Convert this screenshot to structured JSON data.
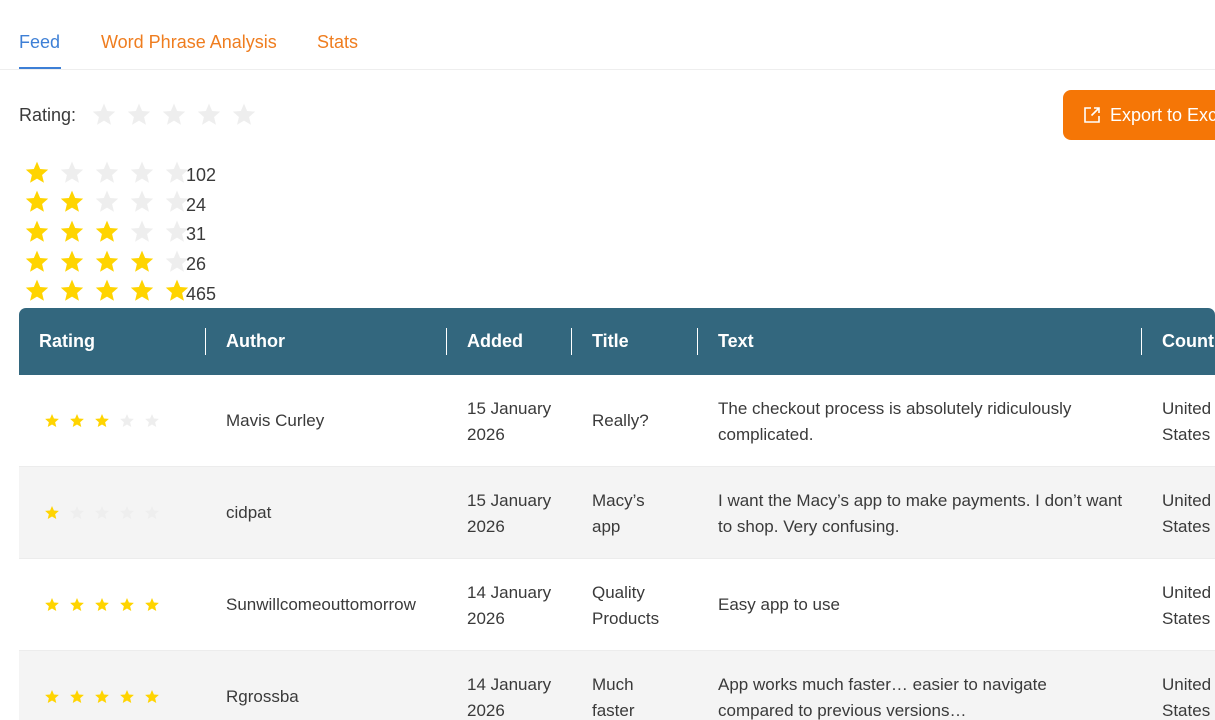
{
  "tabs": [
    {
      "label": "Feed",
      "active": true
    },
    {
      "label": "Word Phrase Analysis",
      "active": false
    },
    {
      "label": "Stats",
      "active": false
    }
  ],
  "filter": {
    "label": "Rating:",
    "selected": 0
  },
  "export": {
    "label": "Export to Excel"
  },
  "distribution": [
    {
      "stars": 1,
      "count": "102"
    },
    {
      "stars": 2,
      "count": "24"
    },
    {
      "stars": 3,
      "count": "31"
    },
    {
      "stars": 4,
      "count": "26"
    },
    {
      "stars": 5,
      "count": "465"
    }
  ],
  "table": {
    "headers": [
      "Rating",
      "Author",
      "Added",
      "Title",
      "Text",
      "Country"
    ],
    "rows": [
      {
        "rating": 3,
        "author": "Mavis Curley",
        "added_line1": "15 January",
        "added_line2": "2026",
        "title_line1": "Really?",
        "title_line2": "",
        "text_line1": "The checkout process is absolutely ridiculously",
        "text_line2": "complicated.",
        "country_line1": "United",
        "country_line2": "States"
      },
      {
        "rating": 1,
        "author": "cidpat",
        "added_line1": "15 January",
        "added_line2": "2026",
        "title_line1": "Macy’s",
        "title_line2": "app",
        "text_line1": "I want the Macy’s app to make payments. I don’t want",
        "text_line2": "to shop. Very confusing.",
        "country_line1": "United",
        "country_line2": "States"
      },
      {
        "rating": 5,
        "author": "Sunwillcomeouttomorrow",
        "added_line1": "14 January",
        "added_line2": "2026",
        "title_line1": "Quality",
        "title_line2": "Products",
        "text_line1": "Easy app to use",
        "text_line2": "",
        "country_line1": "United",
        "country_line2": "States"
      },
      {
        "rating": 5,
        "author": "Rgrossba",
        "added_line1": "14 January",
        "added_line2": "2026",
        "title_line1": "Much",
        "title_line2": "faster",
        "text_line1": "App works much faster… easier to navigate",
        "text_line2": "compared to previous versions…",
        "country_line1": "United",
        "country_line2": "States"
      }
    ]
  },
  "colors": {
    "star_filled": "#ffd400",
    "star_empty": "#eeeeee",
    "accent": "#f57606",
    "header": "#33677e",
    "tab_active": "#3d7fd6",
    "tab_inactive": "#ef7d1f"
  }
}
